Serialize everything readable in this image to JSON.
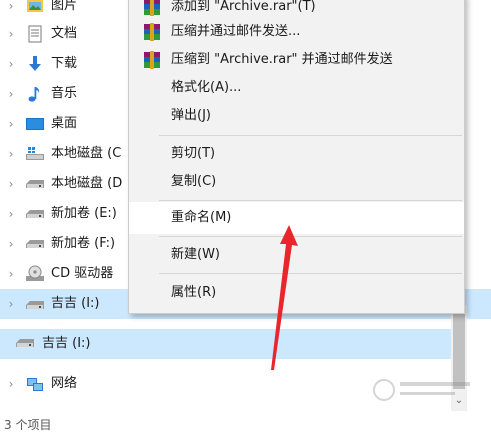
{
  "nav": {
    "items": [
      {
        "label": "图片"
      },
      {
        "label": "文档"
      },
      {
        "label": "下载"
      },
      {
        "label": "音乐"
      },
      {
        "label": "桌面"
      },
      {
        "label": "本地磁盘 (C"
      },
      {
        "label": "本地磁盘 (D"
      },
      {
        "label": "新加卷 (E:)"
      },
      {
        "label": "新加卷 (F:)"
      },
      {
        "label": "CD 驱动器"
      },
      {
        "label": "吉吉 (I:)"
      }
    ],
    "ghost_label": "吉吉 (I:)",
    "network_label": "网络",
    "status_text": "3 个项目"
  },
  "context_menu": {
    "items": [
      {
        "label": "添加到 \"Archive.rar\"(T)"
      },
      {
        "label": "压缩并通过邮件发送..."
      },
      {
        "label": "压缩到 \"Archive.rar\" 并通过邮件发送"
      },
      {
        "label": "格式化(A)..."
      },
      {
        "label": "弹出(J)"
      },
      {
        "label": "剪切(T)"
      },
      {
        "label": "复制(C)"
      },
      {
        "label": "重命名(M)"
      },
      {
        "label": "新建(W)"
      },
      {
        "label": "属性(R)"
      }
    ]
  },
  "colors": {
    "selection": "#cce8ff",
    "menu_bg": "#f2f2f2",
    "arrow": "#e8262b"
  }
}
